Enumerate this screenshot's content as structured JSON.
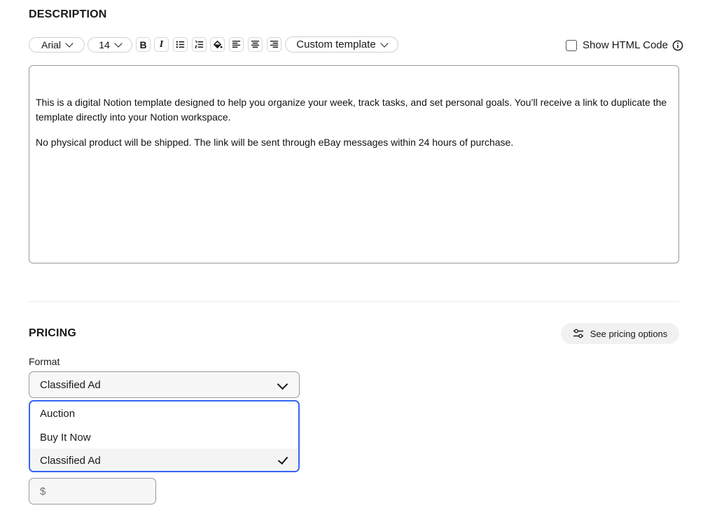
{
  "description": {
    "title": "DESCRIPTION",
    "toolbar": {
      "font_family": "Arial",
      "font_size": "14",
      "template": "Custom template",
      "show_html_label": "Show HTML Code",
      "show_html_checked": false,
      "buttons": [
        "bold-icon",
        "italic-icon",
        "bullet-list-icon",
        "numbered-list-icon",
        "fill-color-icon",
        "align-left-icon",
        "align-center-icon",
        "align-right-icon"
      ]
    },
    "editor": {
      "paragraph1_line1": "This is a digital Notion template designed to help you organize your week, track tasks, and set personal goals. You’ll receive a link to duplicate the",
      "paragraph1_line2": "template directly into your Notion workspace.",
      "paragraph2": "No physical product will be shipped. The link will be sent through eBay messages within 24 hours of purchase."
    }
  },
  "pricing": {
    "title": "PRICING",
    "options_button": "See pricing options",
    "format_label": "Format",
    "format_value": "Classified Ad",
    "format_options": [
      "Auction",
      "Buy It Now",
      "Classified Ad"
    ],
    "selected_option": "Classified Ad",
    "price_placeholder": "$"
  },
  "colors": {
    "accent": "#3665f3",
    "border": "#9a9a9a",
    "text": "#191919"
  }
}
